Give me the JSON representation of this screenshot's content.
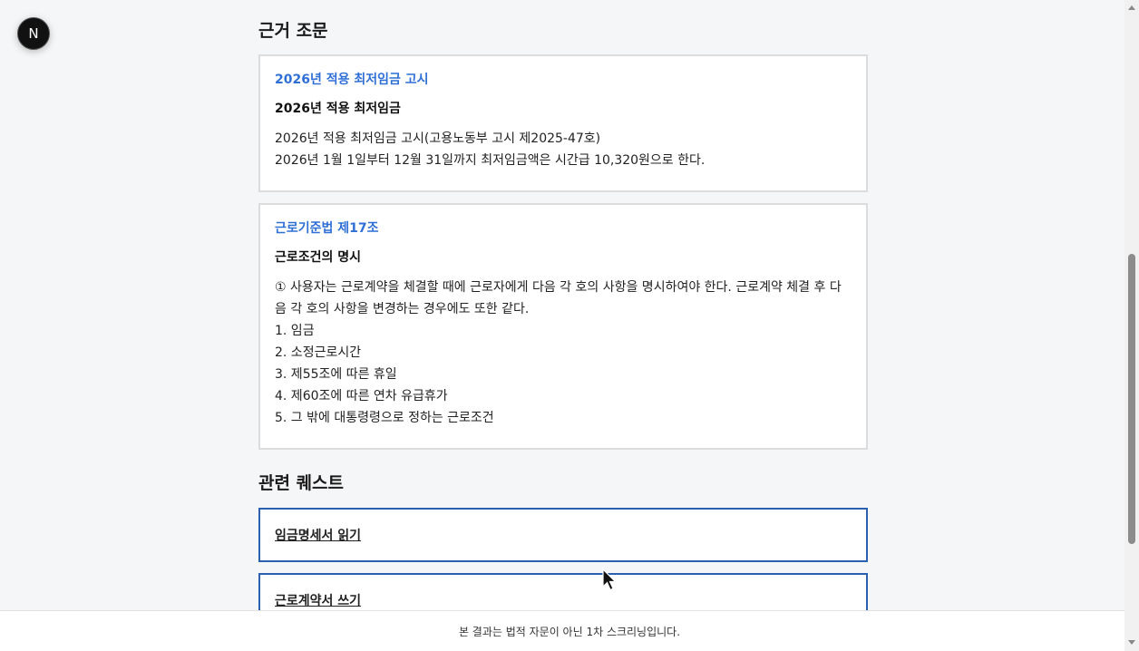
{
  "badge": {
    "letter": "N"
  },
  "basis": {
    "title": "근거 조문",
    "cards": [
      {
        "link": "2026년 적용 최저임금 고시",
        "heading": "2026년 적용 최저임금",
        "lines": [
          "2026년 적용 최저임금 고시(고용노동부 고시 제2025-47호)",
          "2026년 1월 1일부터 12월 31일까지 최저임금액은 시간급 10,320원으로 한다."
        ]
      },
      {
        "link": "근로기준법 제17조",
        "heading": "근로조건의 명시",
        "lines": [
          "① 사용자는 근로계약을 체결할 때에 근로자에게 다음 각 호의 사항을 명시하여야 한다. 근로계약 체결 후 다음 각 호의 사항을 변경하는 경우에도 또한 같다.",
          "1. 임금",
          "2. 소정근로시간",
          "3. 제55조에 따른 휴일",
          "4. 제60조에 따른 연차 유급휴가",
          "5. 그 밖에 대통령령으로 정하는 근로조건"
        ]
      }
    ]
  },
  "related": {
    "title": "관련 퀘스트",
    "items": [
      "임금명세서 읽기",
      "근로계약서 쓰기"
    ]
  },
  "footer": {
    "text": "본 결과는 법적 자문이 아닌 1차 스크리닝입니다."
  }
}
